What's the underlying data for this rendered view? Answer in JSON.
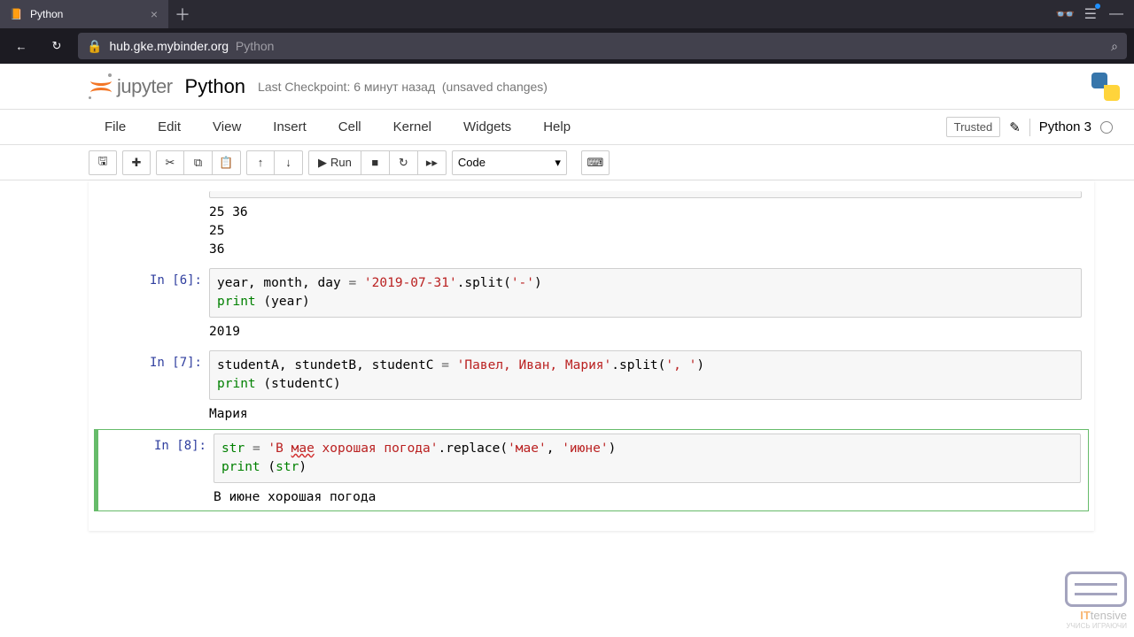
{
  "browser": {
    "tab_title": "Python",
    "url_host": "hub.gke.mybinder.org",
    "url_path": "Python"
  },
  "header": {
    "logo_text": "jupyter",
    "title": "Python",
    "checkpoint": "Last Checkpoint: 6 минут назад",
    "unsaved": "(unsaved changes)"
  },
  "menubar": {
    "items": [
      "File",
      "Edit",
      "View",
      "Insert",
      "Cell",
      "Kernel",
      "Widgets",
      "Help"
    ],
    "trusted": "Trusted",
    "kernel": "Python 3"
  },
  "toolbar": {
    "run_label": "Run",
    "celltype": "Code"
  },
  "cells": [
    {
      "prompt": "",
      "output": "25 36\n25\n36"
    },
    {
      "prompt": "In [6]:",
      "code_html": "<span class='n'>year</span>, <span class='n'>month</span>, <span class='n'>day</span> <span class='o'>=</span> <span class='s'>'2019-07-31'</span>.<span class='n'>split</span>(<span class='s'>'-'</span>)\n<span class='b'>print</span> (<span class='n'>year</span>)",
      "output": "2019"
    },
    {
      "prompt": "In [7]:",
      "code_html": "<span class='n'>studentA</span>, <span class='n'>stundetB</span>, <span class='n'>studentC</span> <span class='o'>=</span> <span class='s'>'Павел, Иван, Мария'</span>.<span class='n'>split</span>(<span class='s'>', '</span>)\n<span class='b'>print</span> (<span class='n'>studentC</span>)",
      "output": "Мария"
    },
    {
      "prompt": "In [8]:",
      "code_html": "<span class='b'>str</span> <span class='o'>=</span> <span class='s'>'В <span class='err'>мае</span> хорошая погода'</span>.<span class='n'>replace</span>(<span class='s'>'мае'</span>, <span class='s'>'июне'</span>)\n<span class='b'>print</span> (<span class='b'>str</span>)",
      "output": "В июне хорошая погода",
      "selected": true
    }
  ],
  "watermark": {
    "brand1": "IT",
    "brand2": "tensive",
    "sub": "УЧИСЬ ИГРАЮЧИ"
  }
}
